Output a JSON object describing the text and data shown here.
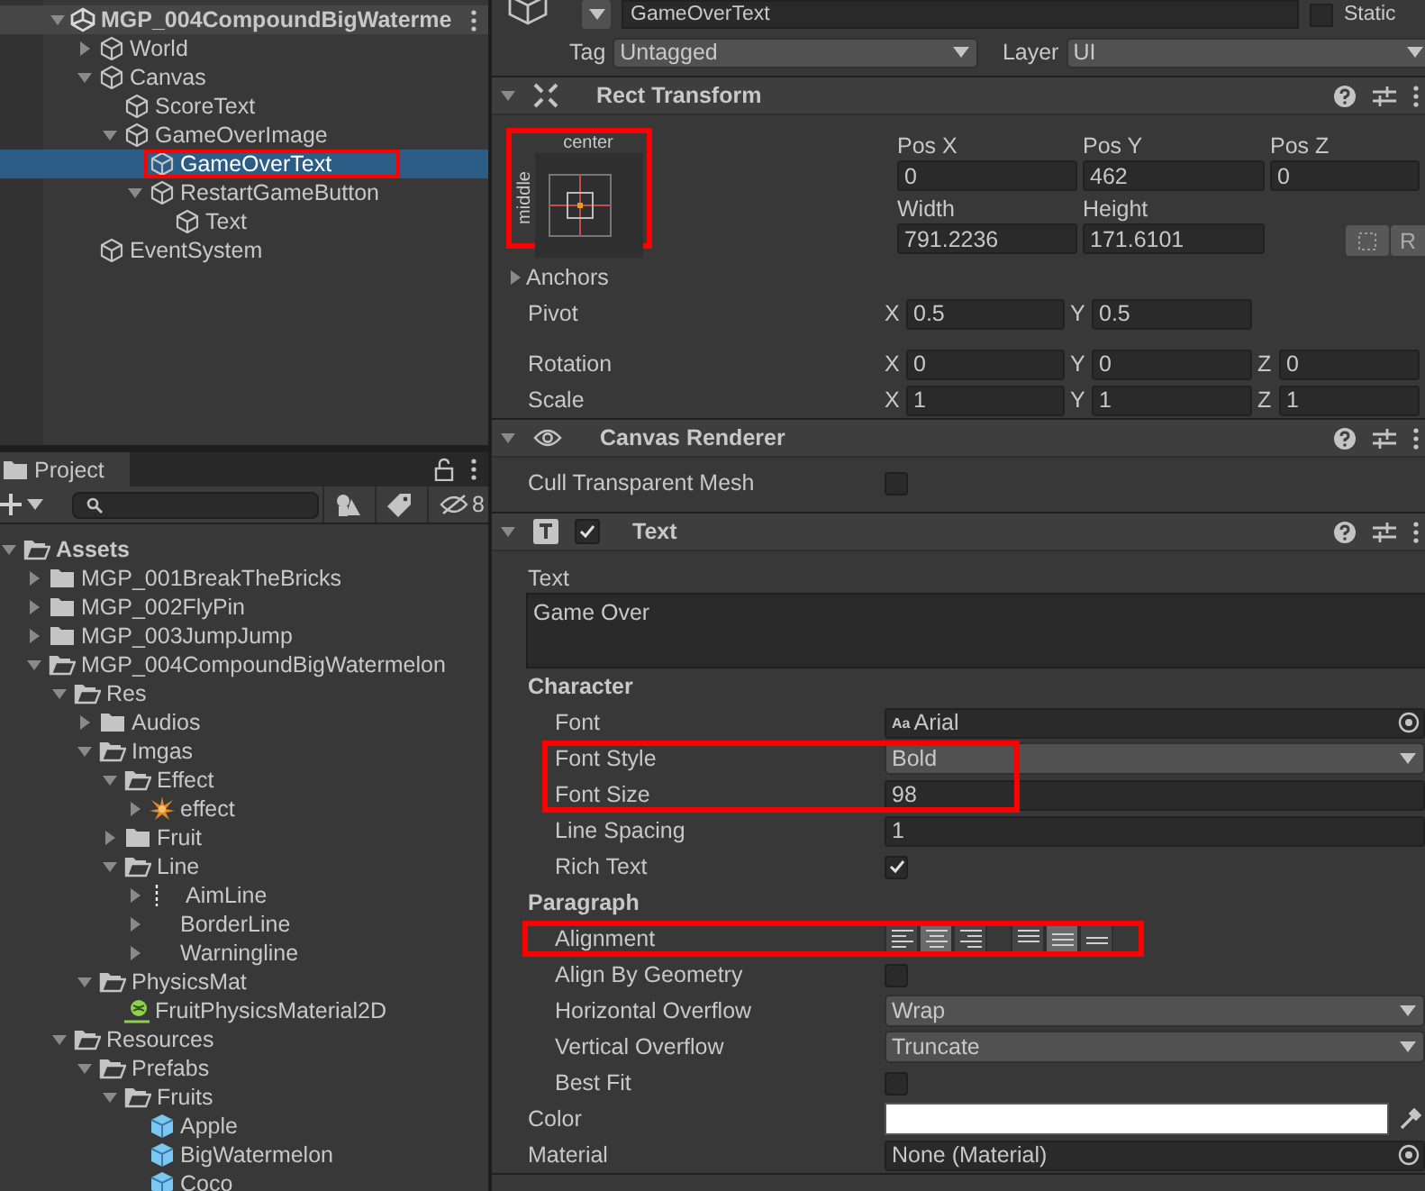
{
  "hierarchy": {
    "scene": {
      "label": "MGP_004CompoundBigWaterme",
      "expanded": true,
      "children": [
        {
          "label": "World",
          "expanded": false,
          "selected": false
        },
        {
          "label": "Canvas",
          "expanded": true,
          "selected": false,
          "children": [
            {
              "label": "ScoreText",
              "selected": false
            },
            {
              "label": "GameOverImage",
              "expanded": true,
              "selected": false,
              "children": [
                {
                  "label": "GameOverText",
                  "selected": true,
                  "highlighted": true
                },
                {
                  "label": "RestartGameButton",
                  "expanded": true,
                  "selected": false,
                  "children": [
                    {
                      "label": "Text",
                      "selected": false
                    }
                  ]
                }
              ]
            }
          ]
        },
        {
          "label": "EventSystem",
          "selected": false
        }
      ]
    }
  },
  "project": {
    "tab": "Project",
    "hidden_count": "8",
    "tree": [
      {
        "label": "Assets",
        "kind": "folder",
        "expanded": true,
        "children": [
          {
            "label": "MGP_001BreakTheBricks",
            "kind": "folder",
            "expanded": false
          },
          {
            "label": "MGP_002FlyPin",
            "kind": "folder",
            "expanded": false
          },
          {
            "label": "MGP_003JumpJump",
            "kind": "folder",
            "expanded": false
          },
          {
            "label": "MGP_004CompoundBigWatermelon",
            "kind": "folder",
            "expanded": true,
            "children": [
              {
                "label": "Res",
                "kind": "folder",
                "expanded": true,
                "children": [
                  {
                    "label": "Audios",
                    "kind": "folder",
                    "expanded": false
                  },
                  {
                    "label": "Imgas",
                    "kind": "folder",
                    "expanded": true,
                    "children": [
                      {
                        "label": "Effect",
                        "kind": "folder",
                        "expanded": true,
                        "children": [
                          {
                            "label": "effect",
                            "kind": "effect",
                            "expanded": false
                          }
                        ]
                      },
                      {
                        "label": "Fruit",
                        "kind": "folder",
                        "expanded": false
                      },
                      {
                        "label": "Line",
                        "kind": "folder",
                        "expanded": true,
                        "children": [
                          {
                            "label": "AimLine",
                            "kind": "dashed",
                            "expanded": false
                          },
                          {
                            "label": "BorderLine",
                            "kind": "plain",
                            "expanded": false
                          },
                          {
                            "label": "Warningline",
                            "kind": "plain",
                            "expanded": false
                          }
                        ]
                      }
                    ]
                  },
                  {
                    "label": "PhysicsMat",
                    "kind": "folder",
                    "expanded": true,
                    "children": [
                      {
                        "label": "FruitPhysicsMaterial2D",
                        "kind": "material"
                      }
                    ]
                  }
                ]
              },
              {
                "label": "Resources",
                "kind": "folder",
                "expanded": true,
                "children": [
                  {
                    "label": "Prefabs",
                    "kind": "folder",
                    "expanded": true,
                    "children": [
                      {
                        "label": "Fruits",
                        "kind": "folder",
                        "expanded": true,
                        "children": [
                          {
                            "label": "Apple",
                            "kind": "prefab"
                          },
                          {
                            "label": "BigWatermelon",
                            "kind": "prefab"
                          },
                          {
                            "label": "Coco",
                            "kind": "prefab"
                          }
                        ]
                      }
                    ]
                  }
                ]
              }
            ]
          }
        ]
      }
    ]
  },
  "inspector": {
    "object": {
      "name": "GameOverText",
      "static_label": "Static",
      "static": false
    },
    "tag": {
      "label": "Tag",
      "value": "Untagged"
    },
    "layer": {
      "label": "Layer",
      "value": "UI"
    },
    "rect_transform": {
      "title": "Rect Transform",
      "anchor": {
        "horizontal": "center",
        "vertical": "middle",
        "highlighted": true
      },
      "position": [
        {
          "label": "Pos X",
          "value": "0"
        },
        {
          "label": "Pos Y",
          "value": "462"
        },
        {
          "label": "Pos Z",
          "value": "0"
        }
      ],
      "size": [
        {
          "label": "Width",
          "value": "791.2236"
        },
        {
          "label": "Height",
          "value": "171.6101"
        }
      ],
      "raw_button": "R",
      "anchors_label": "Anchors",
      "anchors_expanded": false,
      "vectors": [
        {
          "label": "Pivot",
          "fields": [
            {
              "axis": "X",
              "value": "0.5"
            },
            {
              "axis": "Y",
              "value": "0.5"
            }
          ]
        },
        {
          "label": "Rotation",
          "fields": [
            {
              "axis": "X",
              "value": "0"
            },
            {
              "axis": "Y",
              "value": "0"
            },
            {
              "axis": "Z",
              "value": "0"
            }
          ]
        },
        {
          "label": "Scale",
          "fields": [
            {
              "axis": "X",
              "value": "1"
            },
            {
              "axis": "Y",
              "value": "1"
            },
            {
              "axis": "Z",
              "value": "1"
            }
          ]
        }
      ]
    },
    "canvas_renderer": {
      "title": "Canvas Renderer",
      "rows": [
        {
          "kind": "checkbox",
          "label": "Cull Transparent Mesh",
          "checked": false
        }
      ]
    },
    "text": {
      "title": "Text",
      "enabled": true,
      "text_label": "Text",
      "text_value": "Game Over",
      "sections": [
        {
          "title": "Character",
          "rows": [
            {
              "kind": "object",
              "label": "Font",
              "prefix": "Aa",
              "value": "Arial"
            },
            {
              "kind": "dropdown",
              "label": "Font Style",
              "value": "Bold",
              "highlighted": true
            },
            {
              "kind": "number",
              "label": "Font Size",
              "value": "98",
              "highlighted": true
            },
            {
              "kind": "number",
              "label": "Line Spacing",
              "value": "1"
            },
            {
              "kind": "checkbox",
              "label": "Rich Text",
              "checked": true
            }
          ]
        },
        {
          "title": "Paragraph",
          "rows": [
            {
              "kind": "alignment",
              "label": "Alignment",
              "highlighted": true,
              "horizontal": [
                {
                  "selected": false
                },
                {
                  "selected": true
                },
                {
                  "selected": false
                }
              ],
              "vertical": [
                {
                  "selected": false
                },
                {
                  "selected": true
                },
                {
                  "selected": false
                }
              ]
            },
            {
              "kind": "checkbox",
              "label": "Align By Geometry",
              "checked": false
            },
            {
              "kind": "dropdown",
              "label": "Horizontal Overflow",
              "value": "Wrap"
            },
            {
              "kind": "dropdown",
              "label": "Vertical Overflow",
              "value": "Truncate"
            },
            {
              "kind": "checkbox",
              "label": "Best Fit",
              "checked": false
            }
          ]
        }
      ],
      "rows": [
        {
          "kind": "color",
          "label": "Color",
          "color": "#ffffff"
        },
        {
          "kind": "object",
          "label": "Material",
          "value": "None (Material)"
        }
      ]
    }
  }
}
